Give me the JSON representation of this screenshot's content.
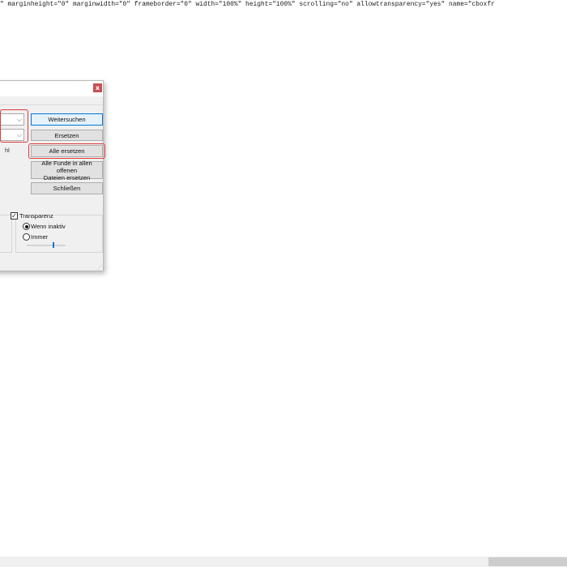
{
  "source_line": "\" marginheight=\"0\" marginwidth=\"0\" frameborder=\"0\" width=\"100%\" height=\"100%\" scrolling=\"no\" allowtransparency=\"yes\" name=\"cboxfr",
  "dialog": {
    "close_glyph": "x",
    "partial_option_text": "hl",
    "buttons": {
      "find_next": "Weitersuchen",
      "replace": "Ersetzen",
      "replace_all": "Alle ersetzen",
      "replace_all_open_line1": "Alle Funde in allen offenen",
      "replace_all_open_line2": "Dateien ersetzen",
      "close": "Schließen"
    },
    "transparency": {
      "label": "Transparenz",
      "checked_glyph": "✓",
      "option_inactive": "Wenn inaktiv",
      "option_always": "Immer",
      "selected": "Wenn inaktiv"
    }
  },
  "icons": {
    "dropdown": "chevron-down-icon",
    "close": "close-icon",
    "grip": "resize-grip-icon"
  },
  "colors": {
    "highlight": "#e03a3a",
    "accent": "#0078d7",
    "close_button": "#c75050"
  }
}
